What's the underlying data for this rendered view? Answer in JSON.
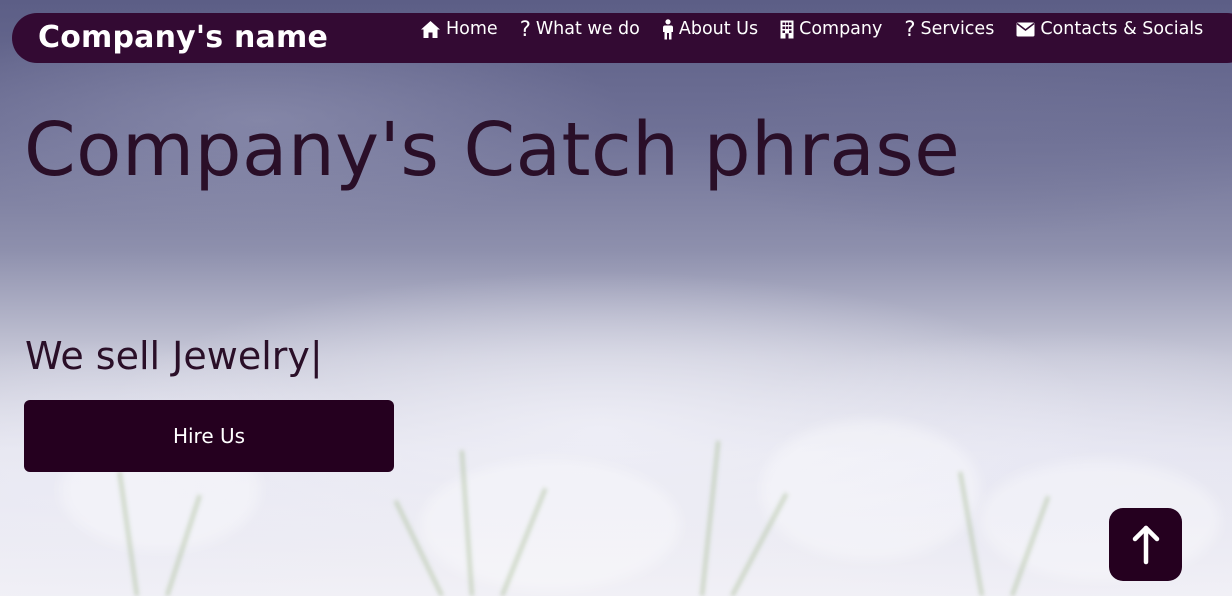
{
  "colors": {
    "navbar_bg": "#330a33",
    "primary_dark": "#25001f",
    "heading_text": "#2a0f28",
    "nav_text": "#ffffff"
  },
  "navbar": {
    "brand": "Company's name",
    "items": [
      {
        "icon": "home-icon",
        "label": "Home"
      },
      {
        "icon": "question-icon",
        "label": "What we do"
      },
      {
        "icon": "person-icon",
        "label": "About Us"
      },
      {
        "icon": "building-icon",
        "label": "Company"
      },
      {
        "icon": "question-icon",
        "label": "Services"
      },
      {
        "icon": "envelope-icon",
        "label": "Contacts & Socials"
      }
    ]
  },
  "hero": {
    "title": "Company's Catch phrase",
    "tagline": "We sell Jewelry",
    "cursor": "|",
    "button_label": "Hire Us"
  },
  "scroll_top": {
    "icon": "arrow-up-icon"
  }
}
